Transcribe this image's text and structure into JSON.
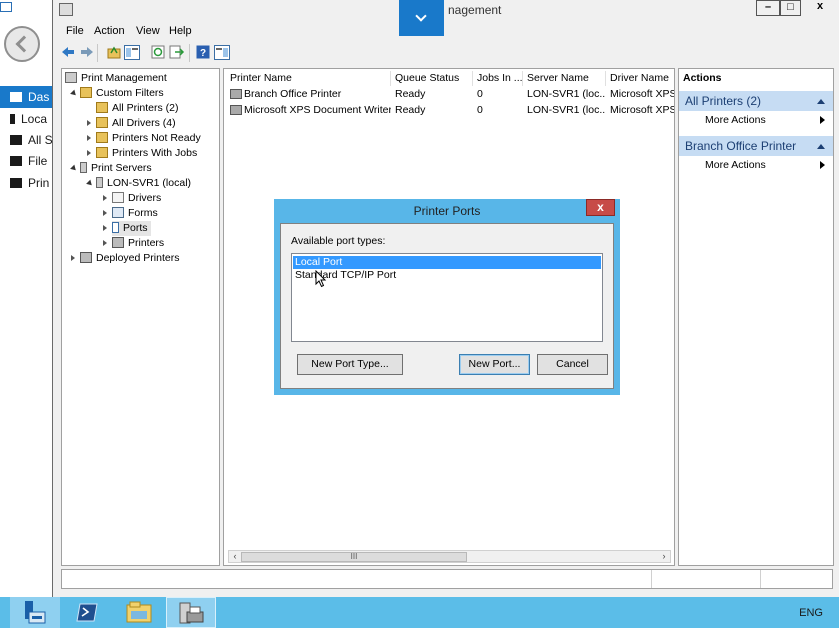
{
  "background": {
    "nav_items": [
      {
        "label": "Das",
        "icon": "dashboard-icon",
        "active": true
      },
      {
        "label": "Loca",
        "icon": "server-icon",
        "active": false
      },
      {
        "label": "All S",
        "icon": "servers-icon",
        "active": false
      },
      {
        "label": "File",
        "icon": "file-services-icon",
        "active": false
      },
      {
        "label": "Prin",
        "icon": "printer-icon",
        "active": false
      }
    ]
  },
  "window": {
    "title": "Print Management",
    "title_visible": "nagement",
    "caption_buttons": [
      "–",
      "□",
      "x"
    ],
    "menu": [
      "File",
      "Action",
      "View",
      "Help"
    ],
    "toolbar_icons": [
      "back-icon",
      "forward-icon",
      "up-folder-icon",
      "show-hide-tree-icon",
      "refresh-icon",
      "export-icon",
      "help-icon",
      "properties-icon"
    ]
  },
  "tree": {
    "root": "Print Management",
    "custom_filters": "Custom Filters",
    "all_printers": "All Printers (2)",
    "all_drivers": "All Drivers (4)",
    "printers_not_ready": "Printers Not Ready",
    "printers_with_jobs": "Printers With Jobs",
    "print_servers": "Print Servers",
    "server": "LON-SVR1 (local)",
    "drivers": "Drivers",
    "forms": "Forms",
    "ports": "Ports",
    "printers": "Printers",
    "deployed_printers": "Deployed Printers"
  },
  "list": {
    "columns": [
      "Printer Name",
      "Queue Status",
      "Jobs In ...",
      "Server Name",
      "Driver Name"
    ],
    "rows": [
      [
        "Branch Office Printer",
        "Ready",
        "0",
        "LON-SVR1 (loc...",
        "Microsoft XPS ("
      ],
      [
        "Microsoft XPS Document Writer",
        "Ready",
        "0",
        "LON-SVR1 (loc...",
        "Microsoft XPS D"
      ]
    ],
    "scroll_grip": "III"
  },
  "actions": {
    "title": "Actions",
    "sections": [
      {
        "header": "All Printers (2)",
        "item": "More Actions"
      },
      {
        "header": "Branch Office Printer",
        "item": "More Actions"
      }
    ]
  },
  "dialog": {
    "title": "Printer Ports",
    "close": "x",
    "label": "Available port types:",
    "options": [
      "Local Port",
      "Standard TCP/IP Port"
    ],
    "selected_index": 0,
    "buttons": {
      "new_port_type": "New Port Type...",
      "new_port": "New Port...",
      "cancel": "Cancel"
    }
  },
  "taskbar": {
    "apps": [
      "server-manager-icon",
      "powershell-icon",
      "file-explorer-icon",
      "print-management-icon"
    ],
    "language": "ENG"
  },
  "colors": {
    "accent": "#1979ca",
    "dialog_frame": "#58b6e8",
    "taskbar": "#5bbde8",
    "selection": "#3399ff",
    "close_red": "#c74b47"
  }
}
